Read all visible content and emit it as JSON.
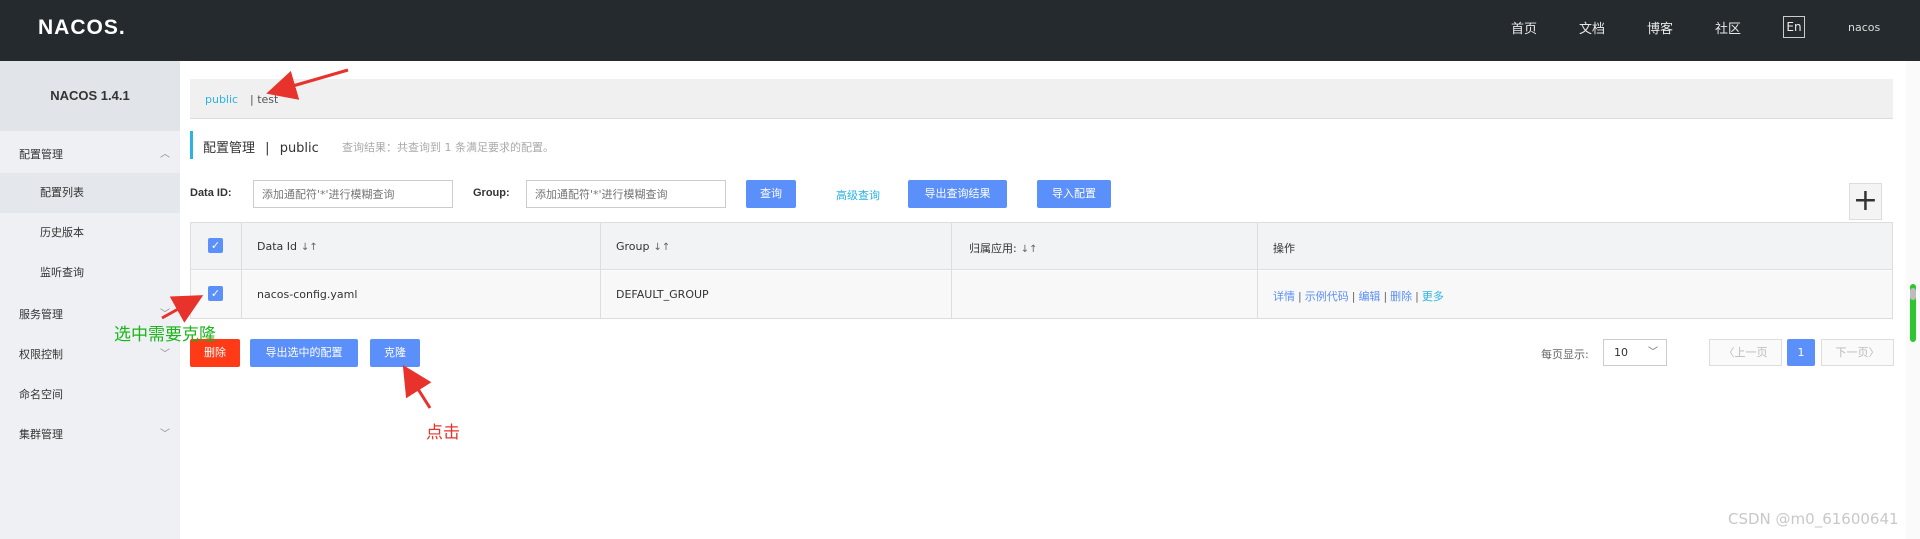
{
  "header": {
    "logo": "NACOS.",
    "nav": [
      "首页",
      "文档",
      "博客",
      "社区"
    ],
    "lang": "En",
    "user": "nacos"
  },
  "sidebar": {
    "version": "NACOS 1.4.1",
    "groups": [
      {
        "label": "配置管理",
        "expanded": true,
        "children": [
          "配置列表",
          "历史版本",
          "监听查询"
        ],
        "active_child": "配置列表"
      },
      {
        "label": "服务管理"
      },
      {
        "label": "权限控制"
      },
      {
        "label": "命名空间"
      },
      {
        "label": "集群管理"
      }
    ]
  },
  "namespace_bar": {
    "active": "public",
    "other": "| test"
  },
  "page_title": {
    "main": "配置管理",
    "separator": "|",
    "namespace": "public",
    "hint": "查询结果：共查询到 1 条满足要求的配置。"
  },
  "search": {
    "data_id_label": "Data ID:",
    "data_id_placeholder": "添加通配符'*'进行模糊查询",
    "group_label": "Group:",
    "group_placeholder": "添加通配符'*'进行模糊查询",
    "query_button": "查询",
    "advanced_query": "高级查询",
    "export_button": "导出查询结果",
    "import_button": "导入配置",
    "add_button": "+"
  },
  "table": {
    "columns": [
      "Data Id",
      "Group",
      "归属应用:",
      "操作"
    ],
    "rows": [
      {
        "checked": true,
        "data_id": "nacos-config.yaml",
        "group": "DEFAULT_GROUP",
        "app": "",
        "ops": [
          "详情",
          "示例代码",
          "编辑",
          "删除",
          "更多"
        ]
      }
    ]
  },
  "bulk_actions": {
    "delete": "删除",
    "export_selected": "导出选中的配置",
    "clone": "克隆"
  },
  "pagination": {
    "per_page_label": "每页显示:",
    "per_page_value": "10",
    "prev": "上一页",
    "current": "1",
    "next": "下一页"
  },
  "annotations": {
    "select_hint": "选中需要克隆",
    "click_hint": "点击"
  },
  "watermark": "CSDN @m0_61600641",
  "colors": {
    "topbar": "#252a2f",
    "primary": "#5b8ff9",
    "danger": "#fe3a17",
    "link": "#2ab3e3",
    "annotation_red": "#e8322c",
    "annotation_green": "#19b519"
  }
}
